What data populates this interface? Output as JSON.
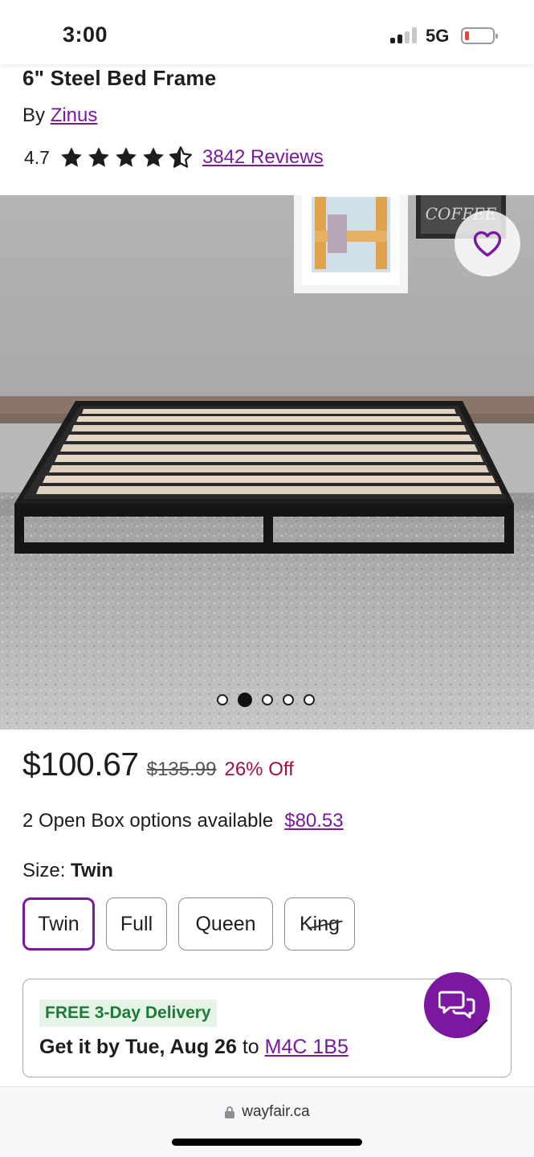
{
  "status_bar": {
    "time": "3:00",
    "network": "5G",
    "battery_color": "#ff3b30"
  },
  "product": {
    "title": "6\" Steel Bed Frame",
    "by_prefix": "By",
    "brand": "Zinus",
    "rating": "4.7",
    "stars": 4.5,
    "reviews_label": "3842 Reviews"
  },
  "gallery": {
    "image_count": 5,
    "active_index": 1,
    "favorite_icon": "heart-outline-icon"
  },
  "pricing": {
    "price": "$100.67",
    "original_price": "$135.99",
    "discount": "26% Off",
    "open_box_text": "2 Open Box options available",
    "open_box_price": "$80.53"
  },
  "size": {
    "label": "Size:",
    "selected": "Twin",
    "options": [
      "Twin",
      "Full",
      "Queen",
      "King"
    ]
  },
  "delivery": {
    "badge": "FREE 3-Day Delivery",
    "prefix": "Get it by Tue, Aug 26",
    "to": "to",
    "postal_code": "M4C 1B5"
  },
  "chat": {
    "icon": "chat-bubbles-icon"
  },
  "browser": {
    "url": "wayfair.ca"
  },
  "colors": {
    "accent": "#7b189f",
    "discount": "#a0113f",
    "free_green": "#1f7a39"
  }
}
